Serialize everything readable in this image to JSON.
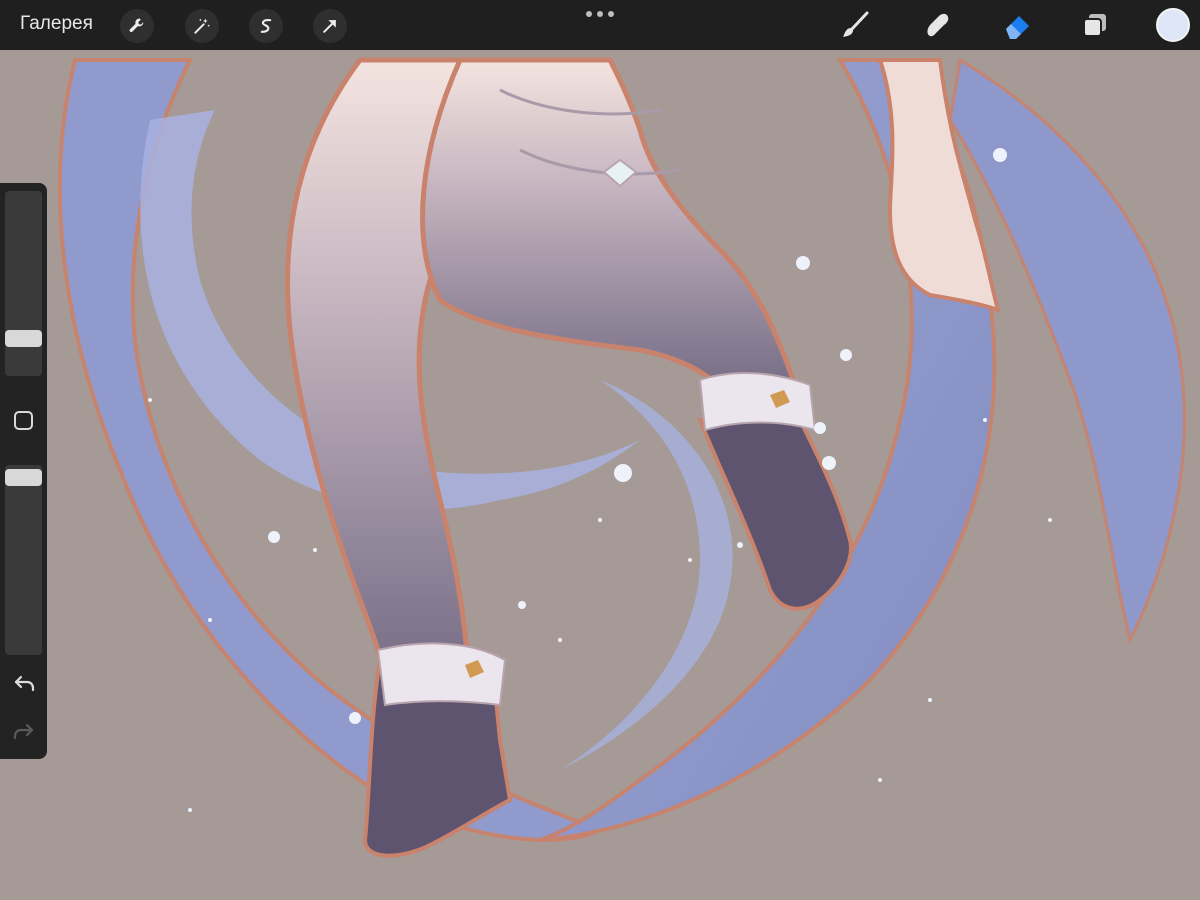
{
  "app": {
    "gallery_label": "Галерея"
  },
  "toolbar": {
    "left_icons": [
      "wrench-icon",
      "magic-wand-icon",
      "selection-s-icon",
      "transform-arrow-icon"
    ],
    "menu_icon": "more-dots-icon",
    "right_icons": [
      "brush-icon",
      "smudge-icon",
      "eraser-icon",
      "layers-icon"
    ],
    "active_tool": "eraser",
    "active_color": "#dfe6f7",
    "accent_color": "#1c7cf2"
  },
  "sidebar": {
    "brush_size_level": 0.3,
    "opacity_level": 0.94,
    "icons": [
      "modify-square-icon",
      "undo-icon",
      "redo-icon"
    ]
  }
}
